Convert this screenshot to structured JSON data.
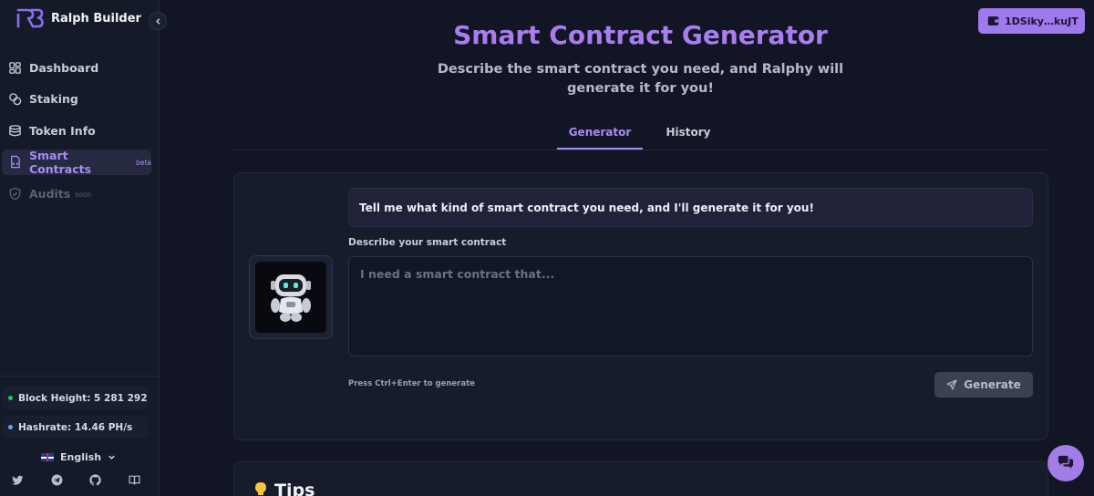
{
  "app": {
    "name": "Ralph Builder"
  },
  "sidebar": {
    "items": [
      {
        "label": "Dashboard",
        "icon": "dashboard-icon"
      },
      {
        "label": "Staking",
        "icon": "coins-icon"
      },
      {
        "label": "Token Info",
        "icon": "token-stack-icon"
      },
      {
        "label": "Smart Contracts",
        "badge": "beta",
        "icon": "file-code-icon",
        "active": true
      },
      {
        "label": "Audits",
        "badge": "soon",
        "icon": "shield-check-icon",
        "disabled": true
      }
    ],
    "stats": [
      {
        "label": "Block Height: 5 281 292",
        "dot_color": "#22c55e"
      },
      {
        "label": "Hashrate: 14.46 PH/s",
        "dot_color": "#60a5fa"
      }
    ],
    "language": "English",
    "socials": [
      "twitter-icon",
      "telegram-icon",
      "github-icon",
      "docs-book-icon"
    ]
  },
  "header": {
    "wallet_label": "1DSiky…kuJT"
  },
  "main": {
    "title": "Smart Contract Generator",
    "subtitle": "Describe the smart contract you need, and Ralphy will generate it for you!",
    "tabs": [
      {
        "label": "Generator",
        "active": true
      },
      {
        "label": "History"
      }
    ],
    "generator": {
      "prompt_message": "Tell me what kind of smart contract you need, and I'll generate it for you!",
      "field_label": "Describe your smart contract",
      "placeholder": "I need a smart contract that...",
      "value": "",
      "hint": "Press Ctrl+Enter to generate",
      "button_label": "Generate"
    },
    "tips": {
      "title": "Tips"
    }
  },
  "colors": {
    "accent": "#a97cf0",
    "background": "#121624",
    "sidebar": "#151a29",
    "wallet_button": "#9f79ee"
  }
}
